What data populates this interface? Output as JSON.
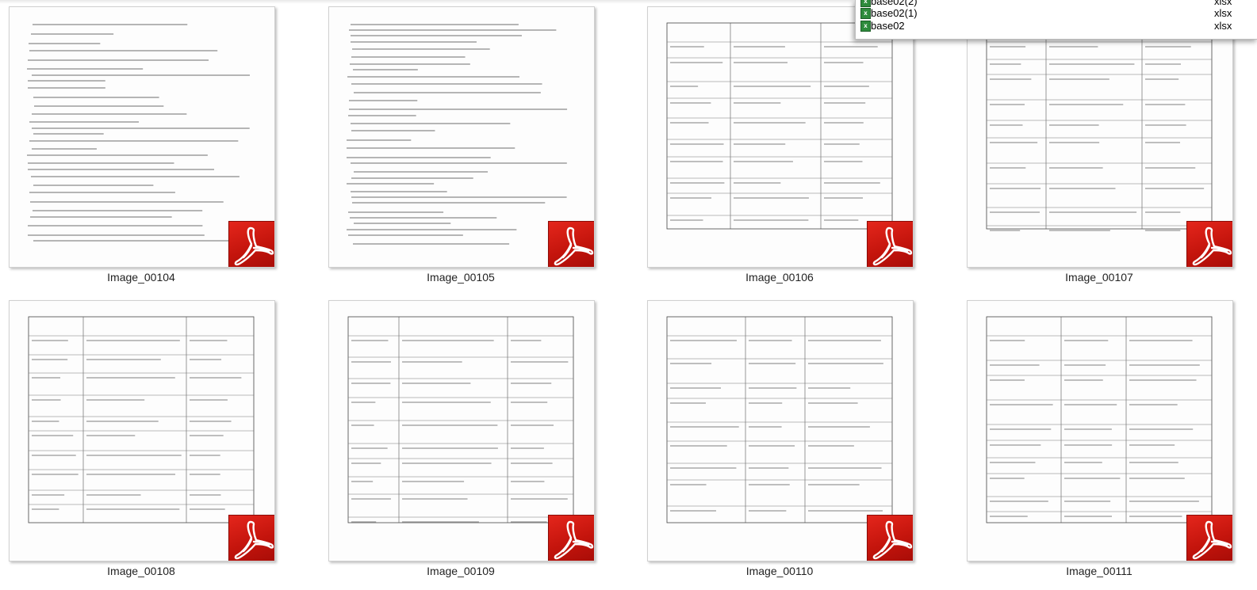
{
  "files": [
    {
      "name": "Image_00104"
    },
    {
      "name": "Image_00105"
    },
    {
      "name": "Image_00106"
    },
    {
      "name": "Image_00107"
    },
    {
      "name": "Image_00108"
    },
    {
      "name": "Image_00109"
    },
    {
      "name": "Image_00110"
    },
    {
      "name": "Image_00111"
    }
  ],
  "popup": {
    "items": [
      {
        "name": "base02(2)",
        "type": "xlsx"
      },
      {
        "name": "base02(1)",
        "type": "xlsx"
      },
      {
        "name": "base02",
        "type": "xlsx"
      }
    ]
  },
  "colors": {
    "pdf_badge": "#c3140c",
    "xlsx_icon": "#2e8b3c"
  },
  "icons": {
    "file_type": "pdf-icon",
    "popup_item": "excel-icon"
  }
}
